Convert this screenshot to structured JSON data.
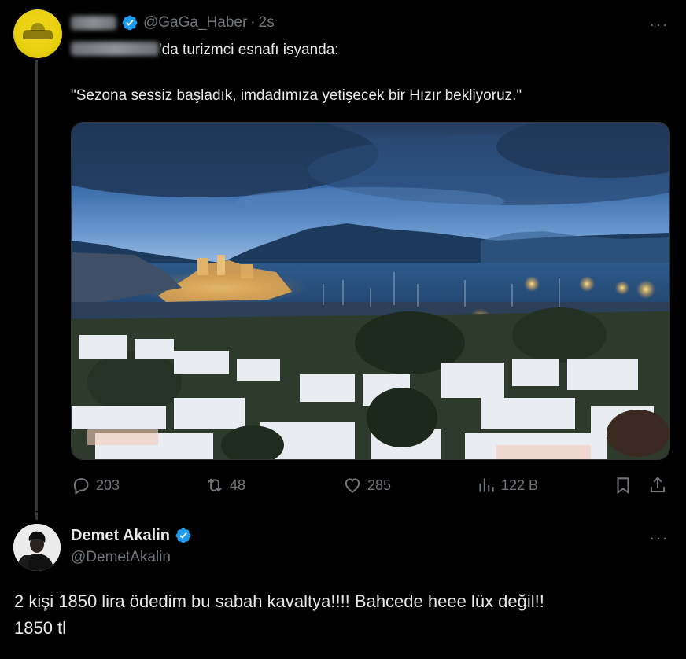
{
  "tweet1": {
    "handle": "@GaGa_Haber",
    "separator": "·",
    "time": "2s",
    "text_line1": "'da turizmci esnafı isyanda:",
    "text_line2": "\"Sezona sessiz başladık, imdadımıza yetişecek bir Hızır bekliyoruz.\"",
    "stats": {
      "replies": "203",
      "reposts": "48",
      "likes": "285",
      "views": "122 B"
    },
    "more": "···"
  },
  "tweet2": {
    "name": "Demet Akalin",
    "handle": "@DemetAkalin",
    "more": "···",
    "text_line1": "2 kişi 1850 lira ödedim bu sabah kavaltya!!!! Bahcede heee lüx değil!!",
    "text_line2": "1850 tl"
  },
  "colors": {
    "background": "#000000",
    "text": "#e7e9ea",
    "secondary": "#71767b",
    "verified": "#1d9bf0",
    "divider": "#333639"
  }
}
